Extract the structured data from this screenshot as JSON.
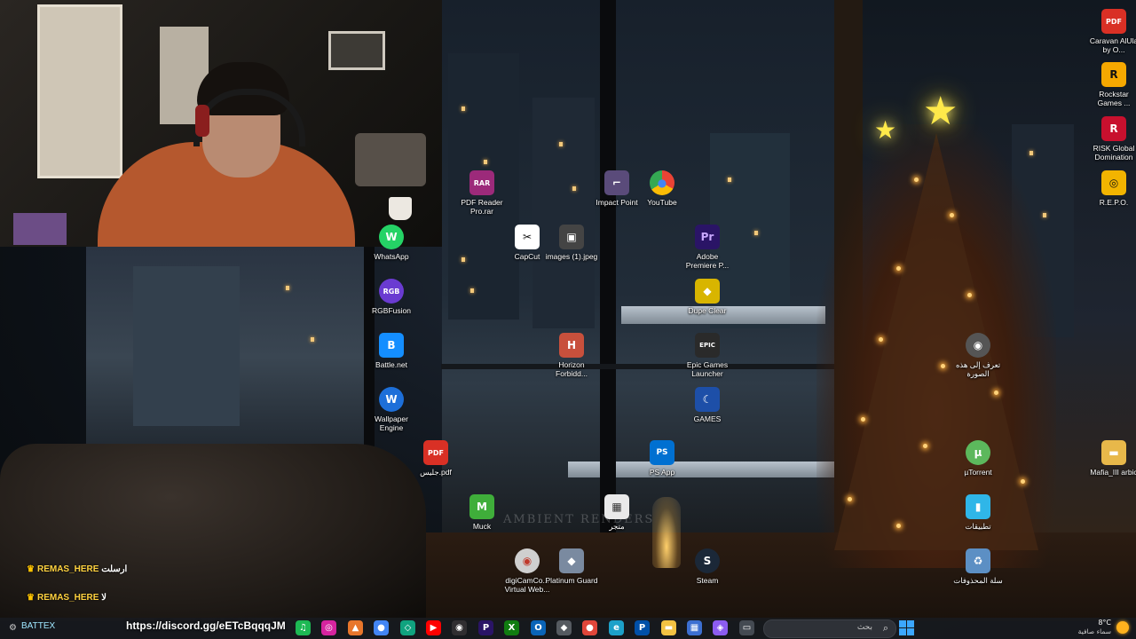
{
  "desktop_icons": {
    "whatsapp": {
      "label": "WhatsApp",
      "glyph": "W",
      "color": "#25d366"
    },
    "rgbfusion": {
      "label": "RGBFusion",
      "glyph": "RGB",
      "color": "#6a3bd1"
    },
    "battlenet": {
      "label": "Battle.net",
      "glyph": "B",
      "color": "#148eff"
    },
    "wallpaper_engine": {
      "label": "Wallpaper Engine",
      "glyph": "W",
      "color": "#1d6fd9"
    },
    "pdf_file": {
      "label": "جليس.pdf",
      "glyph": "PDF",
      "color": "#d93025"
    },
    "pdf_reader": {
      "label": "PDF Reader Pro.rar",
      "glyph": "RAR",
      "color": "#9c2a7a"
    },
    "capcut": {
      "label": "CapCut",
      "glyph": "✂",
      "color": "#111111"
    },
    "images_jpeg": {
      "label": "images (1).jpeg",
      "glyph": "▣",
      "color": "#444444"
    },
    "horizon": {
      "label": "Horizon Forbidd...",
      "glyph": "H",
      "color": "#c8503c"
    },
    "muck": {
      "label": "Muck",
      "glyph": "M",
      "color": "#3fae3a"
    },
    "digicam": {
      "label": "digiCamCo... Virtual Web...",
      "glyph": "◉",
      "color": "#cfcfcf"
    },
    "platinum_guard": {
      "label": "Platinum Guard",
      "glyph": "◆",
      "color": "#7a8aa0"
    },
    "store": {
      "label": "متجر",
      "glyph": "▦",
      "color": "#e9e9e9"
    },
    "impact_point": {
      "label": "Impact Point",
      "glyph": "⌐",
      "color": "#5a4b7a"
    },
    "youtube": {
      "label": "YouTube",
      "glyph": "●",
      "color": "#ea4335"
    },
    "premiere": {
      "label": "Adobe Premiere P...",
      "glyph": "Pr",
      "color": "#2a1466"
    },
    "dupe_clear": {
      "label": "Dupe Clear",
      "glyph": "◆",
      "color": "#d8b500"
    },
    "epic": {
      "label": "Epic Games Launcher",
      "glyph": "EPIC",
      "color": "#2a2a2a"
    },
    "games": {
      "label": "GAMES",
      "glyph": "☾",
      "color": "#1d4fa8"
    },
    "ps_app": {
      "label": "PS App",
      "glyph": "PS",
      "color": "#0070d1"
    },
    "steam": {
      "label": "Steam",
      "glyph": "S",
      "color": "#1b2838"
    },
    "caravan": {
      "label": "Caravan AlUla by O...",
      "glyph": "PDF",
      "color": "#d93025"
    },
    "rockstar": {
      "label": "Rockstar Games ...",
      "glyph": "R",
      "color": "#f6a800"
    },
    "risk": {
      "label": "RISK Global Domination",
      "glyph": "R",
      "color": "#c8102e"
    },
    "repo": {
      "label": "R.E.P.O.",
      "glyph": "◎",
      "color": "#f2b400"
    },
    "learn_image": {
      "label": "تعرف إلى هذه الصورة",
      "glyph": "◉",
      "color": "#555555"
    },
    "utorrent": {
      "label": "µTorrent",
      "glyph": "µ",
      "color": "#5cb85c"
    },
    "apps_folder": {
      "label": "تطبيقات",
      "glyph": "▮",
      "color": "#2fb6e8"
    },
    "mafia_folder": {
      "label": "Mafia_III arbic",
      "glyph": "▬",
      "color": "#e8b84a"
    },
    "recycle_bin": {
      "label": "سلة المحذوفات",
      "glyph": "♻",
      "color": "#5c8fc4"
    }
  },
  "chat": {
    "line1": {
      "user": "REMAS_HERE",
      "text": "ارسلت"
    },
    "line2": {
      "user": "REMAS_HERE",
      "text": "لا"
    }
  },
  "overlay": {
    "discord_link": "https://discord.gg/eETcBqqqJM",
    "stream_name": "BATTEX"
  },
  "wallpaper_watermark": "AMBIENT RENDERS",
  "taskbar": {
    "search_placeholder": "بحث",
    "weather_temp": "8°C",
    "weather_condition": "سماء صافية",
    "apps": [
      {
        "name": "spotify-icon",
        "glyph": "♫",
        "color": "#1db954"
      },
      {
        "name": "instagram-icon",
        "glyph": "◎",
        "color": "#d6249f"
      },
      {
        "name": "vpn-icon",
        "glyph": "▲",
        "color": "#e8762b"
      },
      {
        "name": "chrome-icon",
        "glyph": "●",
        "color": "#4285f4"
      },
      {
        "name": "openai-icon",
        "glyph": "◇",
        "color": "#10a37f"
      },
      {
        "name": "youtube-icon",
        "glyph": "▶",
        "color": "#ff0000"
      },
      {
        "name": "obs-icon",
        "glyph": "◉",
        "color": "#302e31"
      },
      {
        "name": "premiere-icon",
        "glyph": "P",
        "color": "#2a1466"
      },
      {
        "name": "xbox-icon",
        "glyph": "X",
        "color": "#107c10"
      },
      {
        "name": "outlook-icon",
        "glyph": "O",
        "color": "#0a64b8"
      },
      {
        "name": "cube-icon",
        "glyph": "◆",
        "color": "#555a60"
      },
      {
        "name": "record-icon",
        "glyph": "●",
        "color": "#e0463a"
      },
      {
        "name": "edge-icon",
        "glyph": "e",
        "color": "#1da1c9"
      },
      {
        "name": "playstation-icon",
        "glyph": "P",
        "color": "#0050a8"
      },
      {
        "name": "folder-icon",
        "glyph": "▬",
        "color": "#f3c243"
      },
      {
        "name": "store-icon",
        "glyph": "▦",
        "color": "#3c6fd1"
      },
      {
        "name": "copilot-icon",
        "glyph": "◈",
        "color": "#8c5cf0"
      },
      {
        "name": "window-icon",
        "glyph": "▭",
        "color": "#444a52"
      }
    ]
  }
}
